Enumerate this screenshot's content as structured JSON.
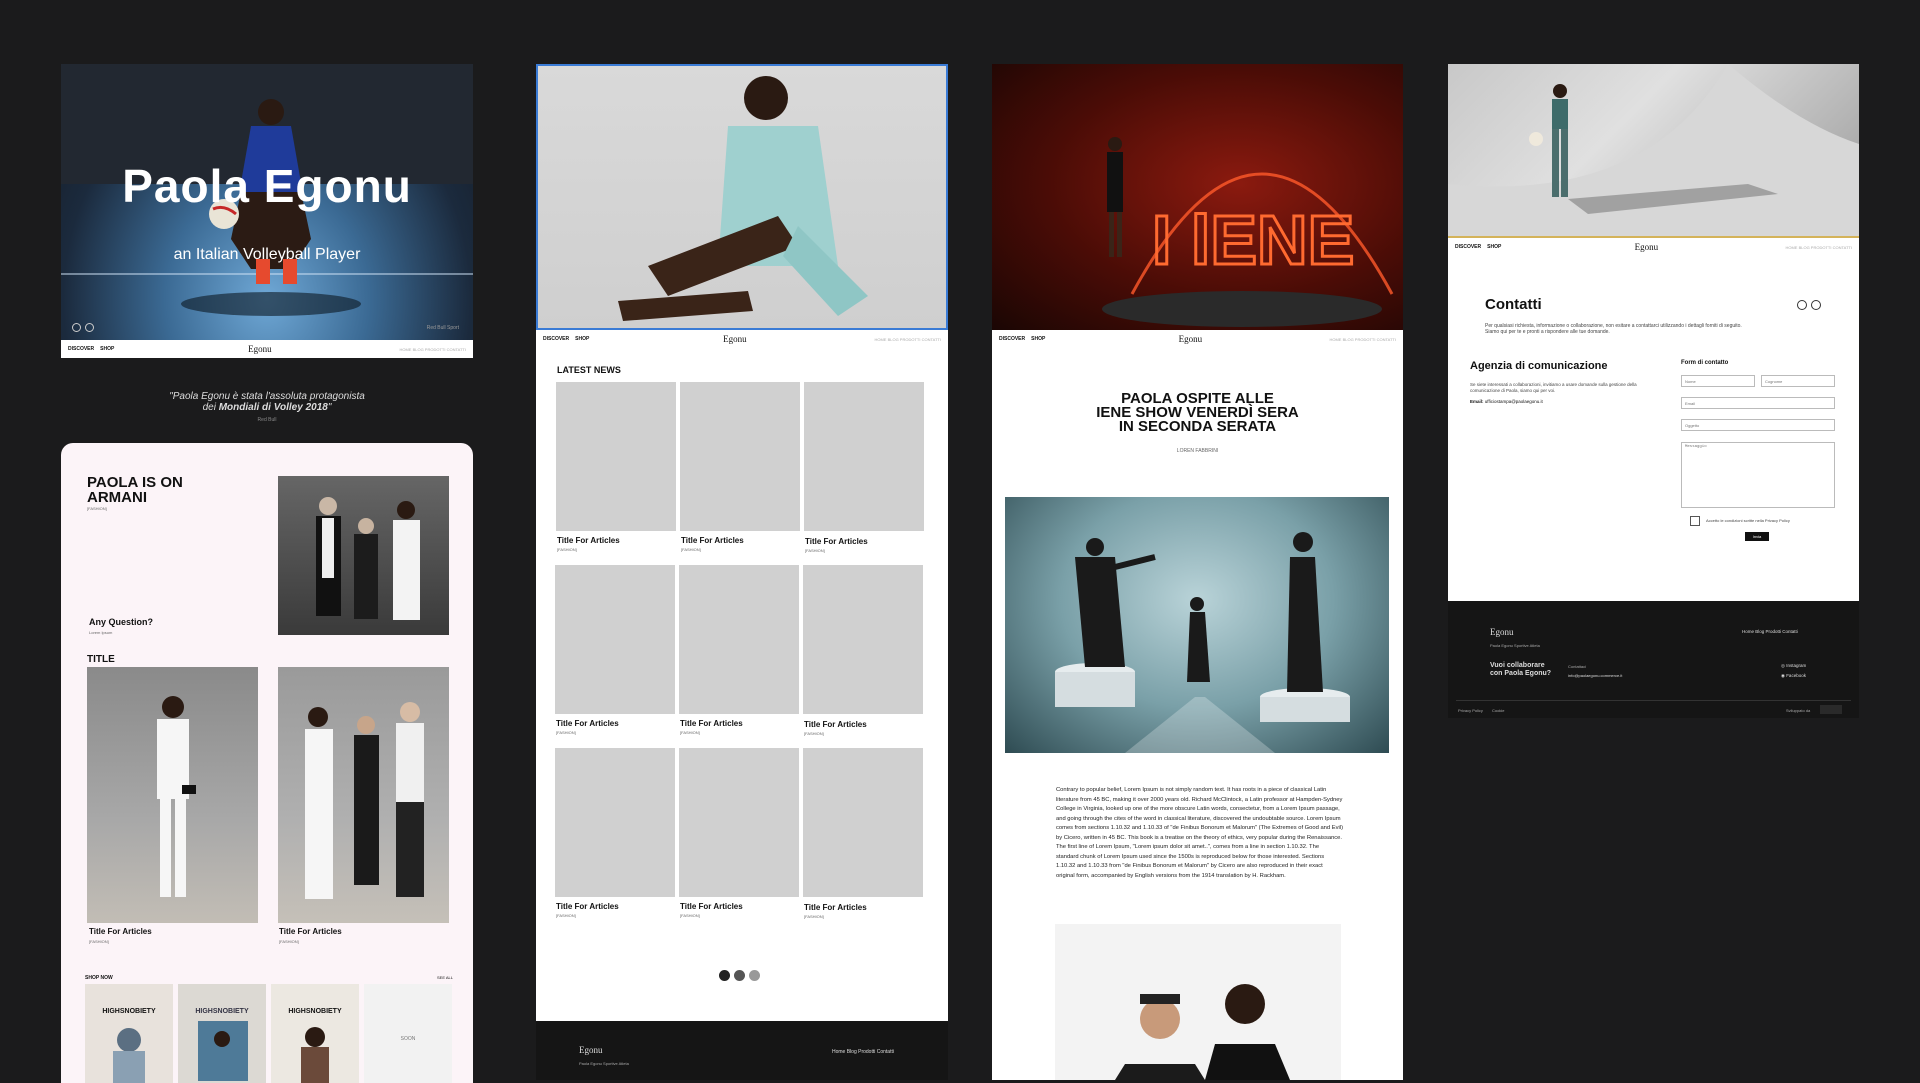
{
  "nav": {
    "discover": "DISCOVER",
    "shop": "SHOP",
    "logo": "Egonu",
    "right_links": "HOME  BLOG  PRODOTTI  CONTATTI"
  },
  "p1": {
    "hero_name": "Paola Egonu",
    "hero_subtitle": "an Italian Volleyball Player",
    "hero_bottom_right": "Red Bull Sport",
    "quote_line1": "\"Paola Egonu è stata l'assoluta protagonista",
    "quote_line2_a": "dei ",
    "quote_line2_b": "Mondiali di Volley 2018",
    "quote_line2_c": "\"",
    "quote_source": "Red Bull",
    "armani_title": "PAOLA IS ON ARMANI",
    "armani_tag": "[FASHION]",
    "question": "Any Question?",
    "question_sub": "Lorem Ipsum",
    "section_title": "TITLE",
    "card1_title": "Title For Articles",
    "card1_tag": "[FASHION]",
    "card2_title": "Title For Articles",
    "card2_tag": "[FASHION]",
    "shop_now": "SHOP NOW",
    "shop_see_all": "SEE ALL",
    "shop_soon": "SOON",
    "mag1": "HIGHSNOBIETY",
    "mag2": "HIGHSNOBIETY",
    "mag3": "HIGHSNOBIETY"
  },
  "p2": {
    "latest_news": "LATEST NEWS",
    "rows": [
      [
        {
          "title": "Title For Articles",
          "tag": "[FASHION]"
        },
        {
          "title": "Title For Articles",
          "tag": "[FASHION]"
        },
        {
          "title": "Title For Articles",
          "tag": "[FASHION]"
        }
      ],
      [
        {
          "title": "Title For Articles",
          "tag": "[FASHION]"
        },
        {
          "title": "Title For Articles",
          "tag": "[FASHION]"
        },
        {
          "title": "Title For Articles",
          "tag": "[FASHION]"
        }
      ],
      [
        {
          "title": "Title For Articles",
          "tag": "[FASHION]"
        },
        {
          "title": "Title For Articles",
          "tag": "[FASHION]"
        },
        {
          "title": "Title For Articles",
          "tag": "[FASHION]"
        }
      ]
    ],
    "footer_logo": "Egonu",
    "footer_links": "Home  Blog  Prodotti  Contatti",
    "footer_sub": "Paola Egonu Sportive Atleta"
  },
  "p3": {
    "headline_1": "PAOLA OSPITE ALLE",
    "headline_2": "IENE SHOW VENERDÌ SERA",
    "headline_3": "IN SECONDA SERATA",
    "byline": "LOREN FABBRINI",
    "body": "Contrary to popular belief, Lorem Ipsum is not simply random text. It has roots in a piece of classical Latin literature from 45 BC, making it over 2000 years old. Richard McClintock, a Latin professor at Hampden-Sydney College in Virginia, looked up one of the more obscure Latin words, consectetur, from a Lorem Ipsum passage, and going through the cites of the word in classical literature, discovered the undoubtable source. Lorem Ipsum comes from sections 1.10.32 and 1.10.33 of \"de Finibus Bonorum et Malorum\" (The Extremes of Good and Evil) by Cicero, written in 45 BC. This book is a treatise on the theory of ethics, very popular during the Renaissance. The first line of Lorem Ipsum, \"Lorem ipsum dolor sit amet..\", comes from a line in section 1.10.32. The standard chunk of Lorem Ipsum used since the 1500s is reproduced below for those interested. Sections 1.10.32 and 1.10.33 from \"de Finibus Bonorum et Malorum\" by Cicero are also reproduced in their exact original form, accompanied by English versions from the 1914 translation by H. Rackham."
  },
  "p4": {
    "contatti": "Contatti",
    "contatti_desc": "Per qualsiasi richiesta, informazione o collaborazione, non esitare a contattarci utilizzando i dettagli forniti di seguito. Siamo qui per te e pronti a rispondere alle tue domande.",
    "agency": "Agenzia di comunicazione",
    "agency_desc": "Se siete interessati a collaborazioni, invitiamo a usare domande sulla gestione della comunicazione di Paola, siamo qui per voi.",
    "email_label": "Email:",
    "email": "ufficiostampa@paolaegonu.it",
    "form_title": "Form di contatto",
    "ph_name": "Nome",
    "ph_surname": "Cognome",
    "ph_email": "Email",
    "ph_subject": "Oggetto",
    "ph_message": "Messaggio",
    "privacy": "Accetto le condizioni scritte nella Privacy Policy",
    "send": "Invia",
    "footer_logo": "Egonu",
    "footer_sub": "Paola Egonu Sportive Atleta",
    "footer_links": "Home  Blog  Prodotti  Contatti",
    "collab_1": "Vuoi collaborare",
    "collab_2": "con Paola Egonu?",
    "contact_label": "Contattaci",
    "contact_email": "info@paolaegonu.commerce.it",
    "instagram": "Instagram",
    "facebook": "Facebook",
    "privacy_link": "Privacy Policy",
    "cookie_link": "Cookie",
    "developed_by": "Sviluppato da"
  }
}
